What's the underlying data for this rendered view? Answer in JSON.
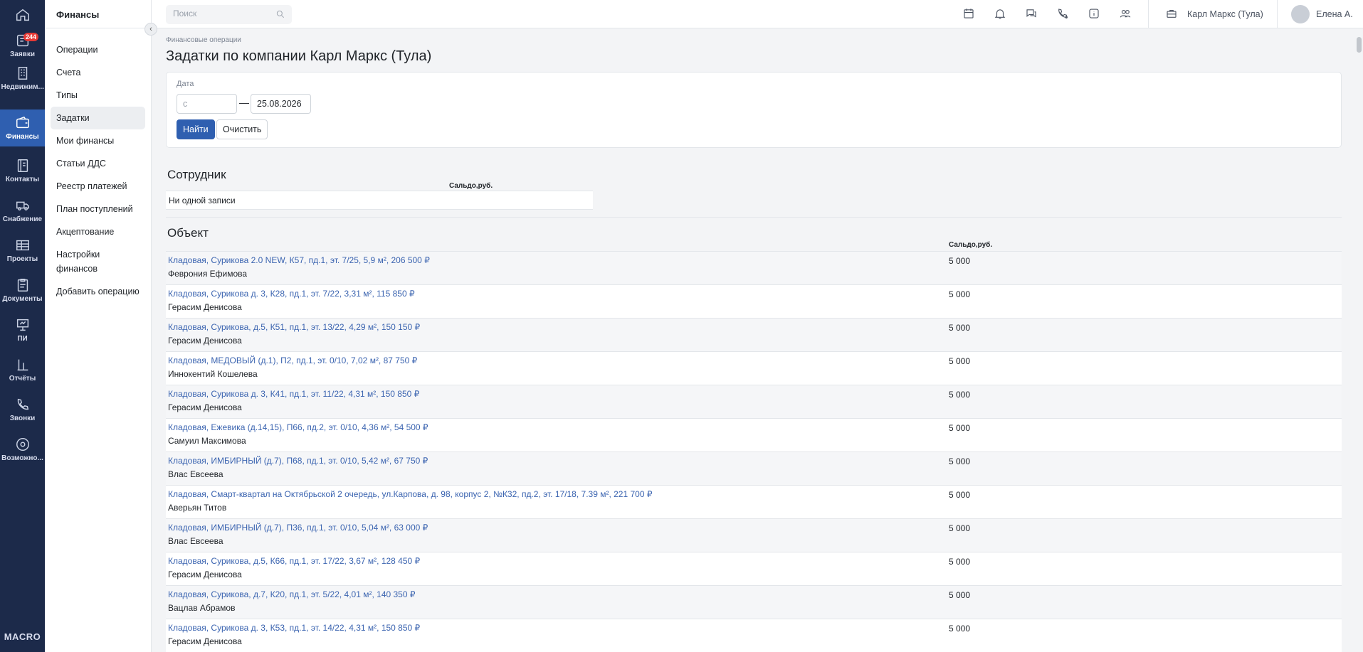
{
  "rail": {
    "items": [
      {
        "label": "",
        "icon": "home-icon"
      },
      {
        "label": "Заявки",
        "icon": "requests-icon",
        "badge": "244"
      },
      {
        "label": "Недвижим...",
        "icon": "building-icon"
      },
      {
        "label": "Финансы",
        "icon": "wallet-icon",
        "active": true
      },
      {
        "label": "Контакты",
        "icon": "contacts-icon"
      },
      {
        "label": "Снабжение",
        "icon": "truck-icon"
      },
      {
        "label": "Проекты",
        "icon": "projects-icon"
      },
      {
        "label": "Документы",
        "icon": "documents-icon"
      },
      {
        "label": "ПИ",
        "icon": "presentation-icon"
      },
      {
        "label": "Отчёты",
        "icon": "reports-icon"
      },
      {
        "label": "Звонки",
        "icon": "phone-icon"
      },
      {
        "label": "Возможно...",
        "icon": "gear-icon"
      }
    ],
    "logo": "MACRO"
  },
  "sidebar": {
    "title": "Финансы",
    "items": [
      {
        "label": "Операции"
      },
      {
        "label": "Счета"
      },
      {
        "label": "Типы"
      },
      {
        "label": "Задатки",
        "active": true
      },
      {
        "label": "Мои финансы"
      },
      {
        "label": "Статьи ДДС"
      },
      {
        "label": "Реестр платежей"
      },
      {
        "label": "План поступлений"
      },
      {
        "label": "Акцептование"
      },
      {
        "label": "Настройки финансов"
      },
      {
        "label": "Добавить операцию"
      }
    ]
  },
  "topbar": {
    "search_placeholder": "Поиск",
    "company": "Карл Маркс (Тула)",
    "user": "Елена А."
  },
  "page": {
    "breadcrumb": "Финансовые операции",
    "title": "Задатки по компании Карл Маркс (Тула)"
  },
  "filter": {
    "date_label": "Дата",
    "from_placeholder": "с",
    "dash": "—",
    "to_value": "25.08.2026",
    "find_label": "Найти",
    "clear_label": "Очистить"
  },
  "employee_section": {
    "title": "Сотрудник",
    "balance_header": "Сальдо,руб.",
    "empty_text": "Ни одной записи"
  },
  "object_section": {
    "title": "Объект",
    "balance_header": "Сальдо,руб.",
    "rows": [
      {
        "object": "Кладовая, Сурикова 2.0 NEW, К57, пд.1, эт. 7/25, 5,9 м², 206 500 ₽",
        "person": "Феврония Ефимова",
        "amount": "5 000"
      },
      {
        "object": "Кладовая, Сурикова д. 3, К28, пд.1, эт. 7/22, 3,31 м², 115 850 ₽",
        "person": "Герасим Денисова",
        "amount": "5 000"
      },
      {
        "object": "Кладовая, Сурикова, д.5, К51, пд.1, эт. 13/22, 4,29 м², 150 150 ₽",
        "person": "Герасим Денисова",
        "amount": "5 000"
      },
      {
        "object": "Кладовая, МЕДОВЫЙ (д.1), П2, пд.1, эт. 0/10, 7,02 м², 87 750 ₽",
        "person": "Иннокентий Кошелева",
        "amount": "5 000"
      },
      {
        "object": "Кладовая, Сурикова д. 3, К41, пд.1, эт. 11/22, 4,31 м², 150 850 ₽",
        "person": "Герасим Денисова",
        "amount": "5 000"
      },
      {
        "object": "Кладовая, Ежевика (д.14,15), П66, пд.2, эт. 0/10, 4,36 м², 54 500 ₽",
        "person": "Самуил Максимова",
        "amount": "5 000"
      },
      {
        "object": "Кладовая, ИМБИРНЫЙ (д.7), П68, пд.1, эт. 0/10, 5,42 м², 67 750 ₽",
        "person": "Влас Евсеева",
        "amount": "5 000"
      },
      {
        "object": "Кладовая, Смарт-квартал на Октябрьской 2 очередь, ул.Карпова, д. 98, корпус 2, №К32, пд.2, эт. 17/18, 7.39 м², 221 700 ₽",
        "person": "Аверьян Титов",
        "amount": "5 000"
      },
      {
        "object": "Кладовая, ИМБИРНЫЙ (д.7), П36, пд.1, эт. 0/10, 5,04 м², 63 000 ₽",
        "person": "Влас Евсеева",
        "amount": "5 000"
      },
      {
        "object": "Кладовая, Сурикова, д.5, К66, пд.1, эт. 17/22, 3,67 м², 128 450 ₽",
        "person": "Герасим Денисова",
        "amount": "5 000"
      },
      {
        "object": "Кладовая, Сурикова, д.7, К20, пд.1, эт. 5/22, 4,01 м², 140 350 ₽",
        "person": "Вацлав Абрамов",
        "amount": "5 000"
      },
      {
        "object": "Кладовая, Сурикова д. 3, К53, пд.1, эт. 14/22, 4,31 м², 150 850 ₽",
        "person": "Герасим Денисова",
        "amount": "5 000"
      }
    ]
  }
}
